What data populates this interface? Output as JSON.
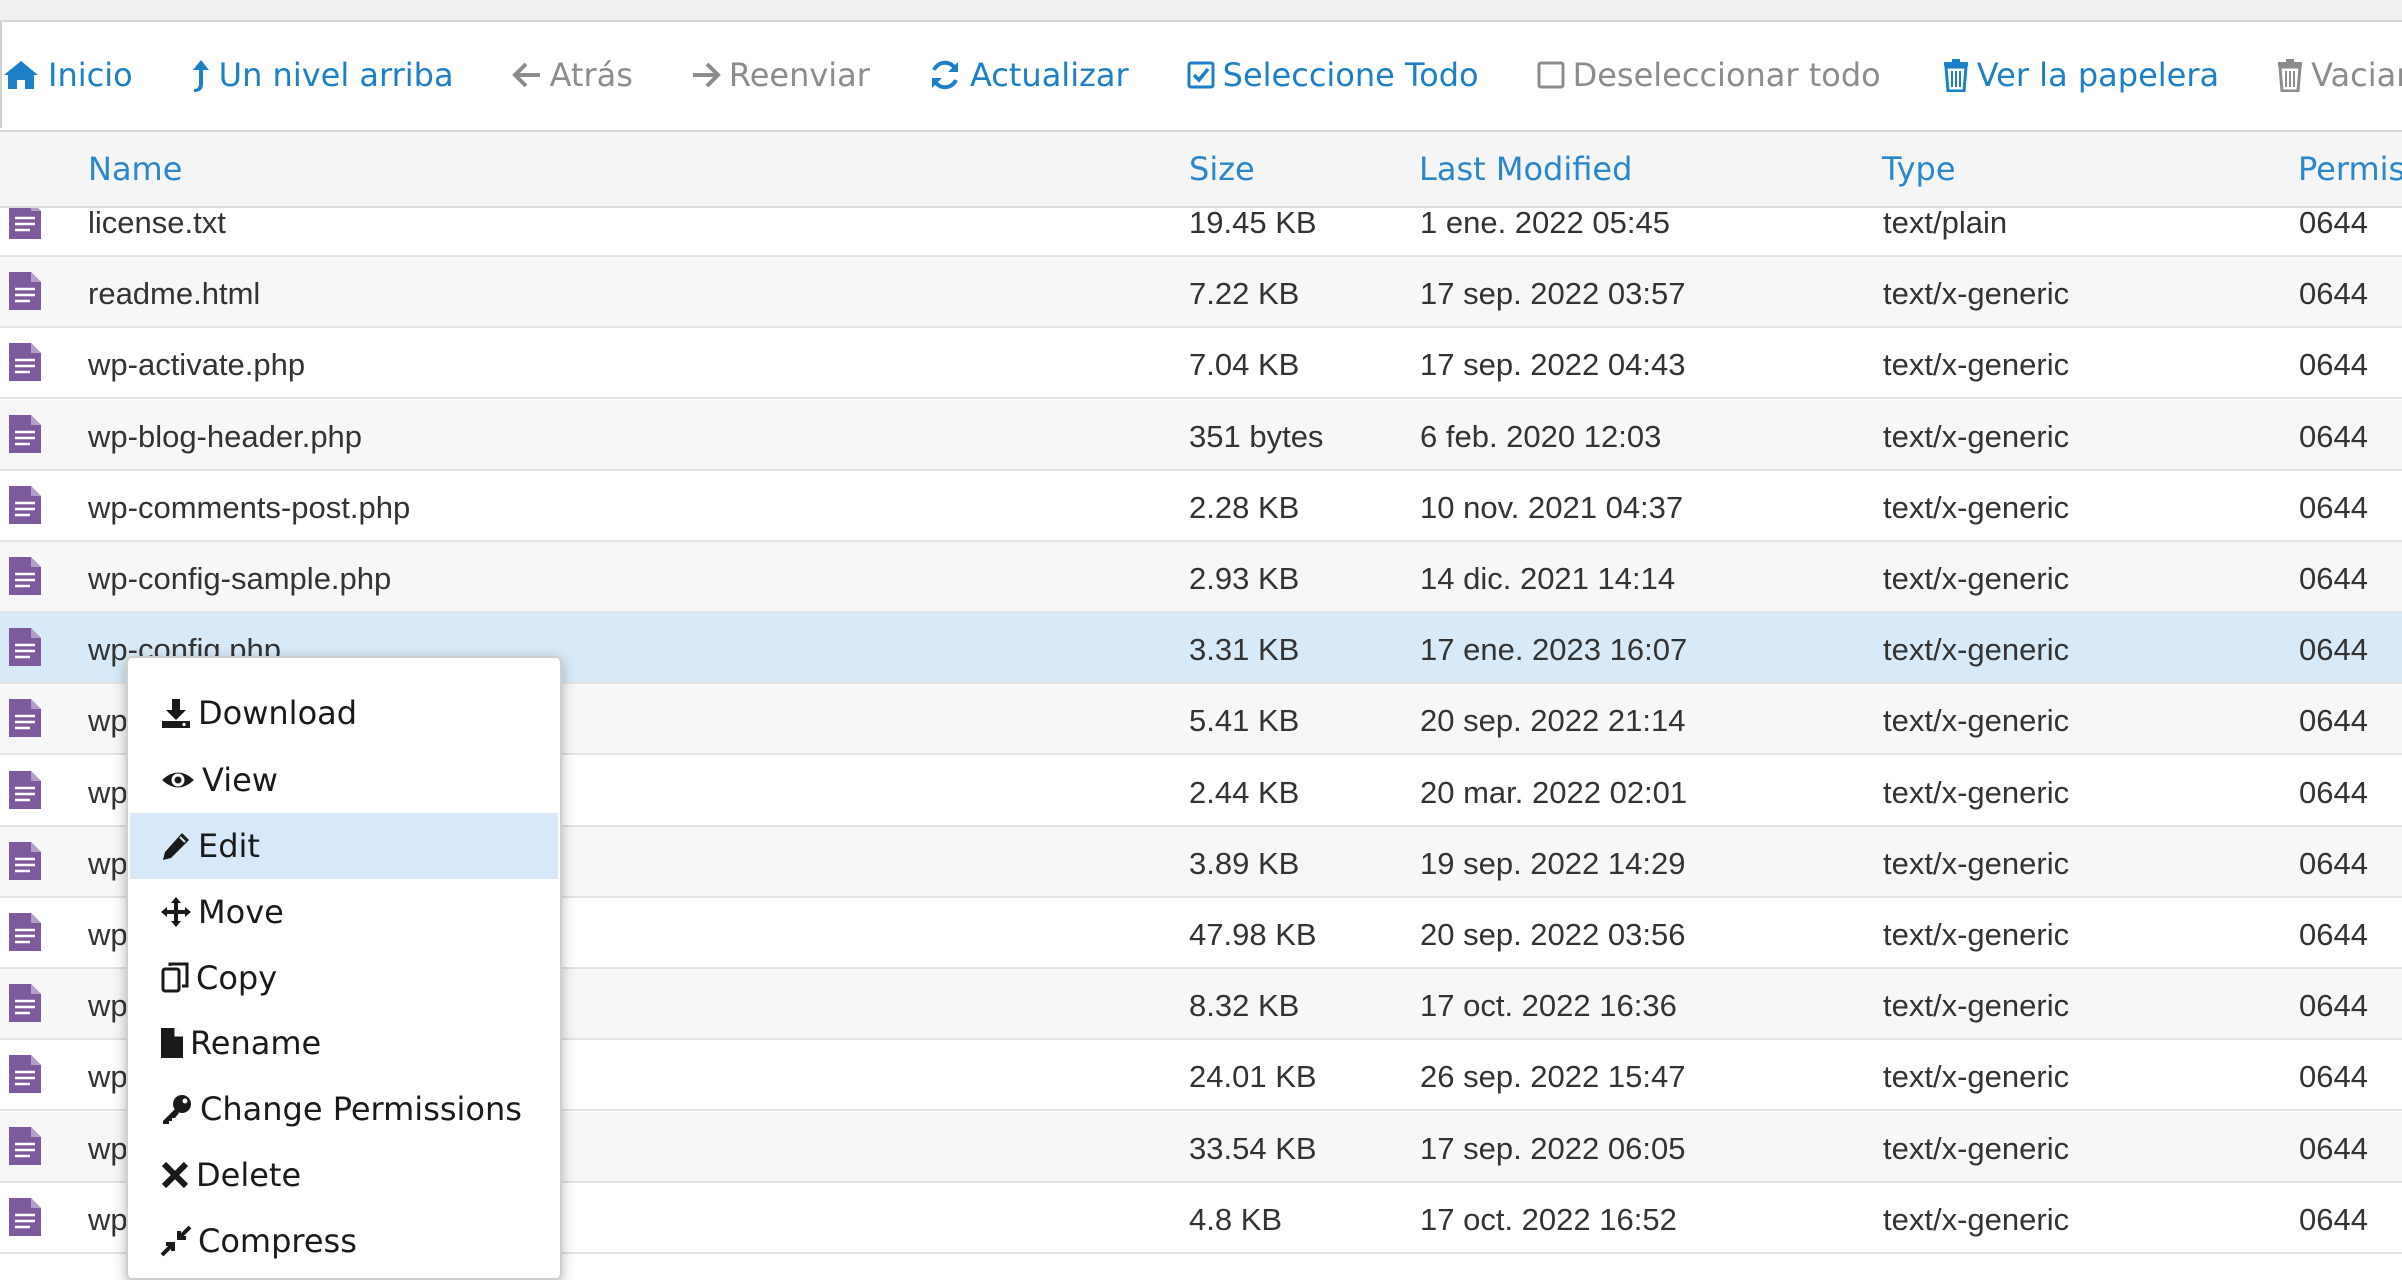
{
  "toolbar": {
    "home": "Inicio",
    "up_one_level": "Un nivel arriba",
    "back": "Atrás",
    "forward": "Reenviar",
    "reload": "Actualizar",
    "select_all": "Seleccione Todo",
    "unselect_all": "Deseleccionar todo",
    "view_trash": "Ver la papelera",
    "empty_trash": "Vaciar pap"
  },
  "table": {
    "columns": [
      "Name",
      "Size",
      "Last Modified",
      "Type",
      "Permiss"
    ],
    "rows": [
      {
        "name": "license.txt",
        "size": "19.45 KB",
        "modified": "1 ene. 2022 05:45",
        "type": "text/plain",
        "perms": "0644"
      },
      {
        "name": "readme.html",
        "size": "7.22 KB",
        "modified": "17 sep. 2022 03:57",
        "type": "text/x-generic",
        "perms": "0644"
      },
      {
        "name": "wp-activate.php",
        "size": "7.04 KB",
        "modified": "17 sep. 2022 04:43",
        "type": "text/x-generic",
        "perms": "0644"
      },
      {
        "name": "wp-blog-header.php",
        "size": "351 bytes",
        "modified": "6 feb. 2020 12:03",
        "type": "text/x-generic",
        "perms": "0644"
      },
      {
        "name": "wp-comments-post.php",
        "size": "2.28 KB",
        "modified": "10 nov. 2021 04:37",
        "type": "text/x-generic",
        "perms": "0644"
      },
      {
        "name": "wp-config-sample.php",
        "size": "2.93 KB",
        "modified": "14 dic. 2021 14:14",
        "type": "text/x-generic",
        "perms": "0644"
      },
      {
        "name": "wp-config.php",
        "size": "3.31 KB",
        "modified": "17 ene. 2023 16:07",
        "type": "text/x-generic",
        "perms": "0644",
        "selected": true
      },
      {
        "name": "wp",
        "size": "5.41 KB",
        "modified": "20 sep. 2022 21:14",
        "type": "text/x-generic",
        "perms": "0644"
      },
      {
        "name": "wp",
        "size": "2.44 KB",
        "modified": "20 mar. 2022 02:01",
        "type": "text/x-generic",
        "perms": "0644"
      },
      {
        "name": "wp",
        "size": "3.89 KB",
        "modified": "19 sep. 2022 14:29",
        "type": "text/x-generic",
        "perms": "0644"
      },
      {
        "name": "wp",
        "size": "47.98 KB",
        "modified": "20 sep. 2022 03:56",
        "type": "text/x-generic",
        "perms": "0644"
      },
      {
        "name": "wp",
        "size": "8.32 KB",
        "modified": "17 oct. 2022 16:36",
        "type": "text/x-generic",
        "perms": "0644"
      },
      {
        "name": "wp",
        "size": "24.01 KB",
        "modified": "26 sep. 2022 15:47",
        "type": "text/x-generic",
        "perms": "0644"
      },
      {
        "name": "wp",
        "size": "33.54 KB",
        "modified": "17 sep. 2022 06:05",
        "type": "text/x-generic",
        "perms": "0644"
      },
      {
        "name": "wp",
        "size": "4.8 KB",
        "modified": "17 oct. 2022 16:52",
        "type": "text/x-generic",
        "perms": "0644"
      }
    ]
  },
  "context_menu": {
    "items": [
      {
        "label": "Download",
        "icon": "download-icon"
      },
      {
        "label": "View",
        "icon": "eye-icon"
      },
      {
        "label": "Edit",
        "icon": "pencil-icon",
        "active": true
      },
      {
        "label": "Move",
        "icon": "move-icon"
      },
      {
        "label": "Copy",
        "icon": "copy-icon"
      },
      {
        "label": "Rename",
        "icon": "file-icon"
      },
      {
        "label": "Change Permissions",
        "icon": "key-icon"
      },
      {
        "label": "Delete",
        "icon": "x-icon"
      },
      {
        "label": "Compress",
        "icon": "compress-icon"
      }
    ]
  },
  "colors": {
    "link_blue": "#1d7fc6",
    "disabled_gray": "#8c8c8c",
    "selected_row": "#d8eaf8",
    "file_icon_purple": "#7d5a9b"
  }
}
